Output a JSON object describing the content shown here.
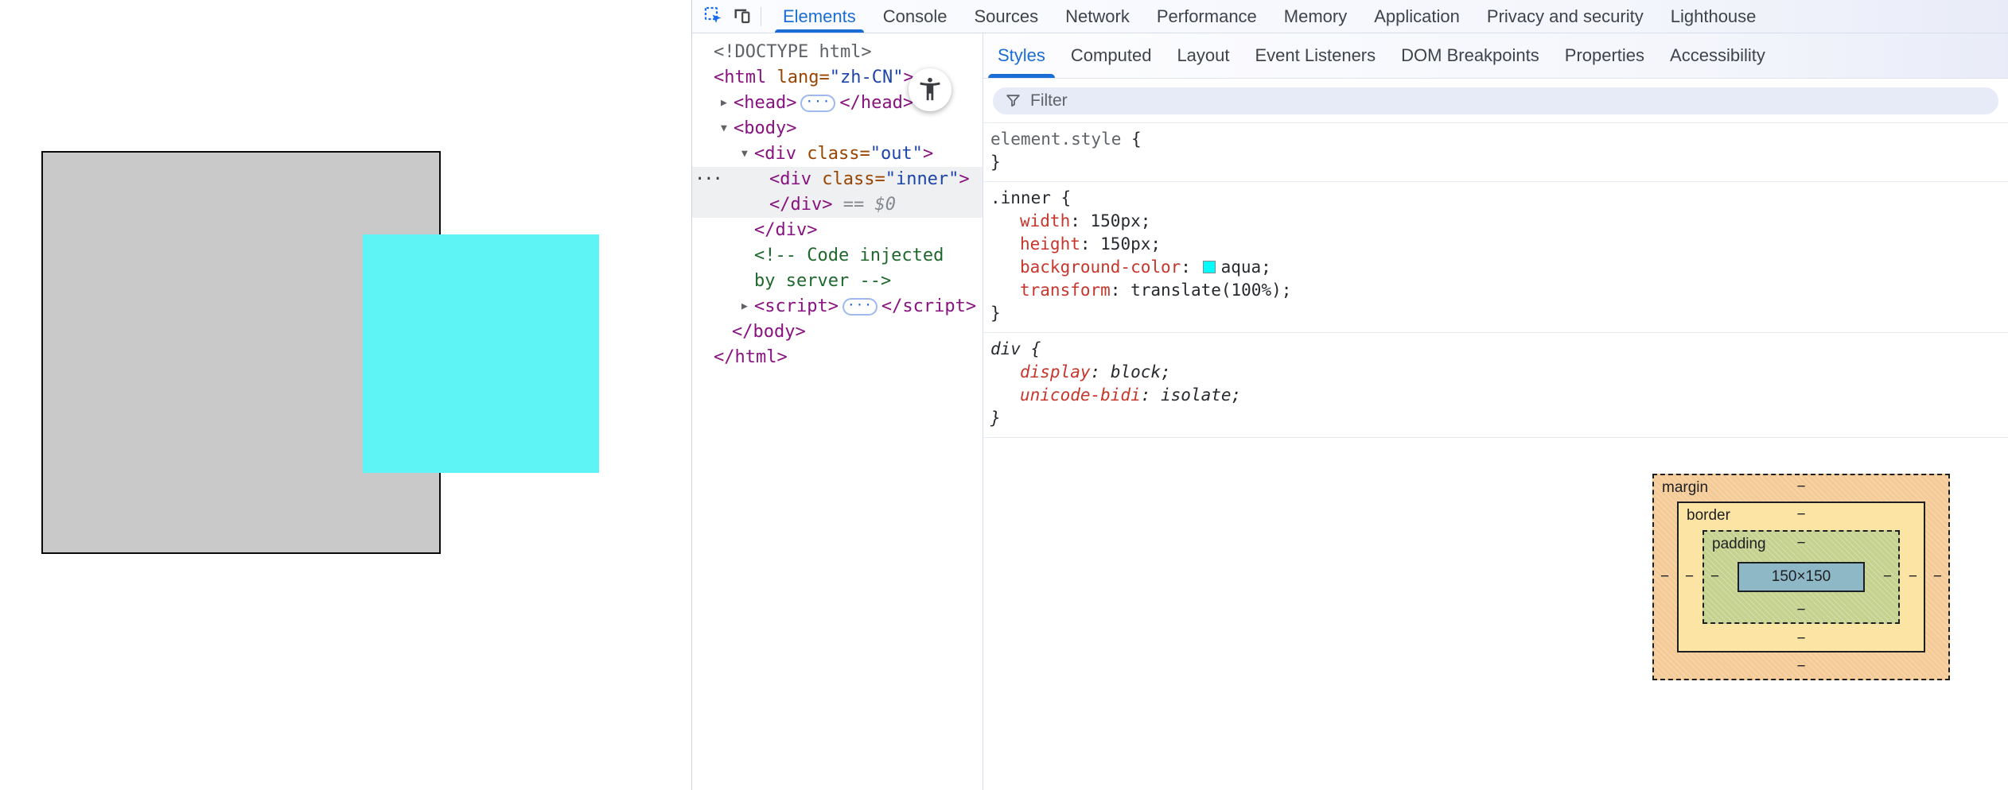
{
  "devtools": {
    "main_toolbar": {
      "tabs": [
        {
          "label": "Elements"
        },
        {
          "label": "Console"
        },
        {
          "label": "Sources"
        },
        {
          "label": "Network"
        },
        {
          "label": "Performance"
        },
        {
          "label": "Memory"
        },
        {
          "label": "Application"
        },
        {
          "label": "Privacy and security"
        },
        {
          "label": "Lighthouse"
        }
      ]
    },
    "sidebar_tabs": [
      {
        "label": "Styles"
      },
      {
        "label": "Computed"
      },
      {
        "label": "Layout"
      },
      {
        "label": "Event Listeners"
      },
      {
        "label": "DOM Breakpoints"
      },
      {
        "label": "Properties"
      },
      {
        "label": "Accessibility"
      }
    ],
    "filter": {
      "placeholder": "Filter"
    },
    "tree": {
      "collapsed_arrow": "▶",
      "expanded_arrow": "▼",
      "gutter_dots": "···",
      "inline_dots": "···",
      "doctype": "<!DOCTYPE html>",
      "html_open": {
        "a": "<html",
        "b": " lang=",
        "c": "\"zh-CN\"",
        "d": ">"
      },
      "head_open": "<head>",
      "head_close": "</head>",
      "body_open": "<body>",
      "div_out": {
        "a": "<div",
        "b": " class=",
        "c": "\"out\"",
        "d": ">"
      },
      "div_inner": {
        "a": "<div",
        "b": " class=",
        "c": "\"inner\"",
        "d": ">"
      },
      "inner_close": "</div>",
      "selected_hint_eq": "==",
      "selected_hint_var": "$0",
      "out_close": "</div>",
      "comment": "<!-- Code injected by server -->",
      "script_open": "<script>",
      "script_close": "</script>",
      "body_close": "</body>",
      "html_close": "</html>"
    },
    "styles_pane": {
      "tokens": {
        "colon": ": ",
        "semi": ";",
        "brace_open": " {",
        "brace_close": "}"
      },
      "element_style": {
        "selector": "element.style"
      },
      "rule_inner": {
        "selector": ".inner",
        "swatch_color": "#00ffff",
        "props": [
          {
            "name": "width",
            "value": "150px"
          },
          {
            "name": "height",
            "value": "150px"
          },
          {
            "name": "background-color",
            "value": "aqua"
          },
          {
            "name": "transform",
            "value": "translate(100%)"
          }
        ]
      },
      "rule_div": {
        "selector": "div",
        "props": [
          {
            "name": "display",
            "value": "block"
          },
          {
            "name": "unicode-bidi",
            "value": "isolate"
          }
        ]
      }
    },
    "box_model": {
      "margin": "margin",
      "border": "border",
      "padding": "padding",
      "content": "150×150",
      "dash": "−",
      "margin_bg": "#f4ca97",
      "border_bg": "#fce4a4",
      "padding_bg": "#c5d18e",
      "content_bg": "#8fb8c7"
    },
    "colors": {
      "accent_blue": "#1a6dd5",
      "tag": "#881280",
      "attr_name": "#994500",
      "attr_value": "#1d45a8",
      "comment_green": "#1e682c",
      "property_red": "#c7362c",
      "selection_bg": "#eff0f2"
    }
  }
}
